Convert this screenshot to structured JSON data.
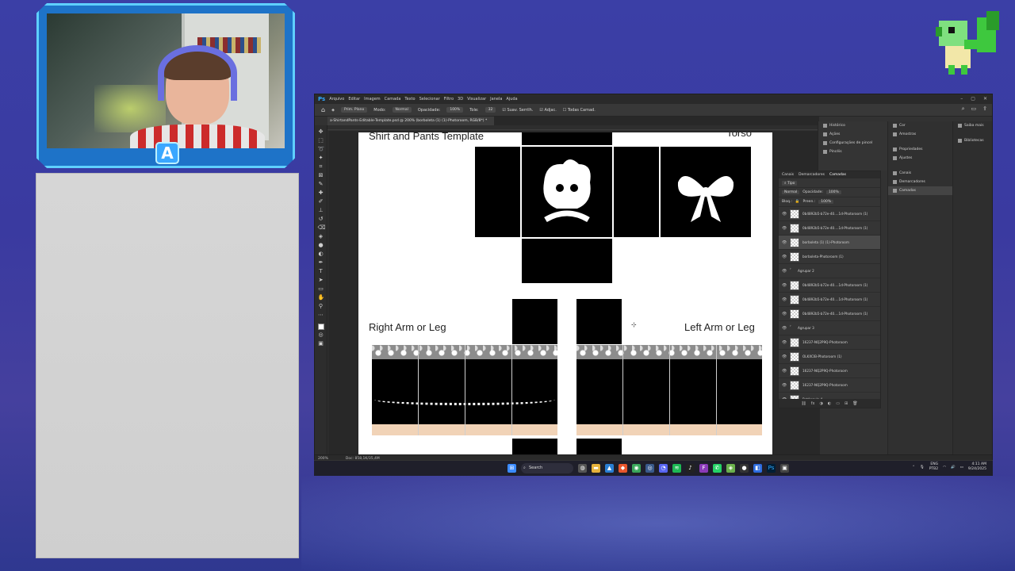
{
  "photoshop": {
    "menu": [
      "Arquivo",
      "Editar",
      "Imagem",
      "Camada",
      "Texto",
      "Selecionar",
      "Filtro",
      "3D",
      "Visualizar",
      "Janela",
      "Ajuda"
    ],
    "options": {
      "mode_label": "Prim. Plano",
      "modo": "Modo:",
      "modo_value": "Normal",
      "opacidade": "Opacidade:",
      "opacidade_value": "100%",
      "tole": "Tole:",
      "tole_value": "32",
      "suav": "Suav. Serrilh.",
      "adjac": "Adjac.",
      "todas": "Todas Camad."
    },
    "doc_tab": "a-ShirtandPants-Editable-Template.psd @ 200% (borboleta (1) (1)-Photoroom, RGB/8*) *",
    "canvas": {
      "title": "Shirt and Pants Template",
      "torso": "Torso",
      "right_arm": "Right Arm or Leg",
      "left_arm": "Left Arm or Leg"
    },
    "status": {
      "zoom": "200%",
      "doc": "Doc: 858,1K/35,4M"
    },
    "panels_col1": [
      "Histórico",
      "Ações",
      "Configurações de pincel",
      "Pincéis"
    ],
    "panels_col2": [
      "Cor",
      "Amostras",
      "Propriedades",
      "Ajustes",
      "Canais",
      "Demarcadores",
      "Camadas"
    ],
    "panels_col3": [
      "Saiba mais",
      "Bibliotecas"
    ],
    "layers_panel": {
      "tabs": [
        "Canais",
        "Demarcadores",
        "Camadas"
      ],
      "filter": "Tipo",
      "blend": "Normal",
      "opacity_label": "Opacidade:",
      "opacity_value": "100%",
      "lock_label": "Bloq.:",
      "fill_label": "Preen.:",
      "fill_value": "100%",
      "layers": [
        {
          "name": "0b4892b5-b72e-40....1d-Photoroom (1)",
          "type": "layer",
          "selected": false
        },
        {
          "name": "0b4892b5-b72e-40....1d-Photoroom (1)",
          "type": "layer",
          "selected": false
        },
        {
          "name": "borboleta (1) (1)-Photoroom",
          "type": "layer",
          "selected": true
        },
        {
          "name": "borboleta-Photoroom (1)",
          "type": "layer",
          "selected": false
        },
        {
          "name": "Agrupar 2",
          "type": "group",
          "selected": false
        },
        {
          "name": "0b4892b5-b72e-40....1d-Photoroom (1)",
          "type": "layer",
          "selected": false
        },
        {
          "name": "0b4892b5-b72e-40....1d-Photoroom (1)",
          "type": "layer",
          "selected": false
        },
        {
          "name": "0b4892b5-b72e-40....1d-Photoroom (1)",
          "type": "layer",
          "selected": false
        },
        {
          "name": "Agrupar 3",
          "type": "group",
          "selected": false
        },
        {
          "name": "16237-NQ2P9Q-Photoroom",
          "type": "layer",
          "selected": false
        },
        {
          "name": "OLKXCIB-Photoroom (1)",
          "type": "layer",
          "selected": false
        },
        {
          "name": "16237-NQ2P9Q-Photoroom",
          "type": "layer",
          "selected": false
        },
        {
          "name": "16237-NQ2P9Q-Photoroom",
          "type": "layer",
          "selected": false
        },
        {
          "name": "Retângulo 4",
          "type": "layer",
          "selected": false
        }
      ]
    }
  },
  "taskbar": {
    "search": "Search",
    "lang": "ENG",
    "lang2": "PTB2",
    "time": "4:11 AM",
    "date": "9/24/2025"
  },
  "webcam": {
    "badge": "A"
  },
  "colors": {
    "accent": "#31a8ff",
    "frame": "#5fd0ff",
    "bg": "#3b3fa6"
  }
}
